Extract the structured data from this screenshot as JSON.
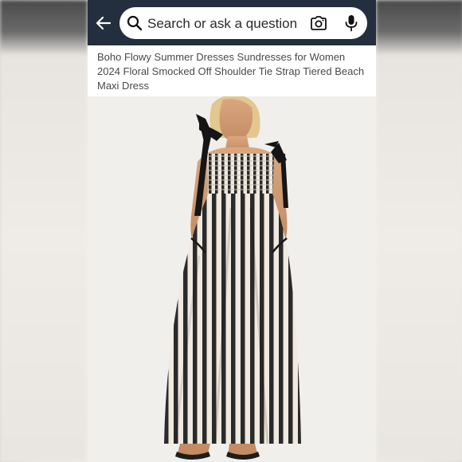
{
  "search": {
    "placeholder": "Search or ask a question"
  },
  "product": {
    "title_partial_line": "Product title line partially hidden under search bar",
    "title": "Boho Flowy Summer Dresses Sundresses for Women 2024 Floral Smocked Off Shoulder Tie Strap Tiered Beach Maxi Dress"
  },
  "icons": {
    "back": "arrow-left-icon",
    "search": "search-icon",
    "camera": "camera-search-icon",
    "mic": "microphone-icon"
  },
  "colors": {
    "header_bg": "#232f3e",
    "title_text": "#4a4a4a",
    "stripe_dark": "#2a2a2a",
    "stripe_light": "#efe9df"
  }
}
